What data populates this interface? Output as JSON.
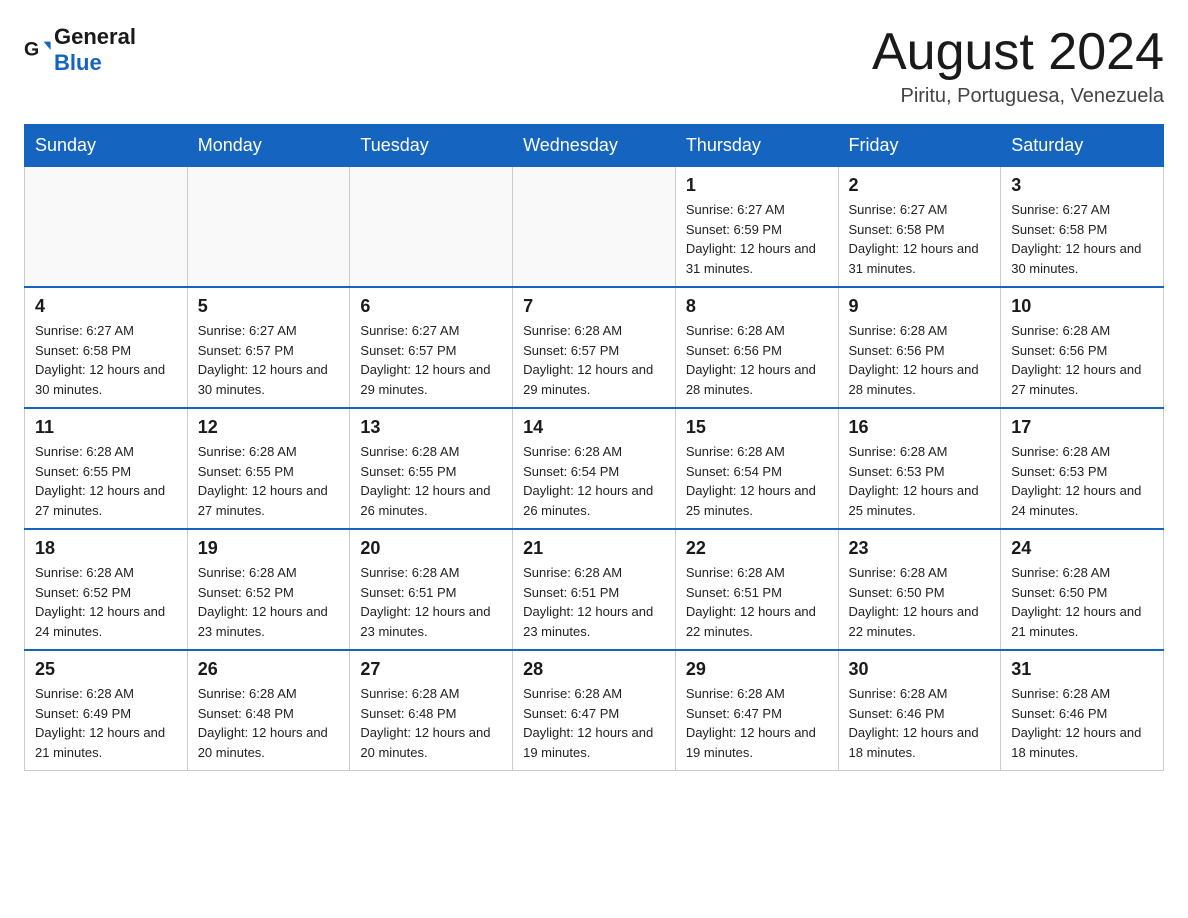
{
  "header": {
    "logo_text_general": "General",
    "logo_text_blue": "Blue",
    "month_title": "August 2024",
    "location": "Piritu, Portuguesa, Venezuela"
  },
  "weekdays": [
    "Sunday",
    "Monday",
    "Tuesday",
    "Wednesday",
    "Thursday",
    "Friday",
    "Saturday"
  ],
  "weeks": [
    [
      {
        "day": "",
        "info": ""
      },
      {
        "day": "",
        "info": ""
      },
      {
        "day": "",
        "info": ""
      },
      {
        "day": "",
        "info": ""
      },
      {
        "day": "1",
        "info": "Sunrise: 6:27 AM\nSunset: 6:59 PM\nDaylight: 12 hours and 31 minutes."
      },
      {
        "day": "2",
        "info": "Sunrise: 6:27 AM\nSunset: 6:58 PM\nDaylight: 12 hours and 31 minutes."
      },
      {
        "day": "3",
        "info": "Sunrise: 6:27 AM\nSunset: 6:58 PM\nDaylight: 12 hours and 30 minutes."
      }
    ],
    [
      {
        "day": "4",
        "info": "Sunrise: 6:27 AM\nSunset: 6:58 PM\nDaylight: 12 hours and 30 minutes."
      },
      {
        "day": "5",
        "info": "Sunrise: 6:27 AM\nSunset: 6:57 PM\nDaylight: 12 hours and 30 minutes."
      },
      {
        "day": "6",
        "info": "Sunrise: 6:27 AM\nSunset: 6:57 PM\nDaylight: 12 hours and 29 minutes."
      },
      {
        "day": "7",
        "info": "Sunrise: 6:28 AM\nSunset: 6:57 PM\nDaylight: 12 hours and 29 minutes."
      },
      {
        "day": "8",
        "info": "Sunrise: 6:28 AM\nSunset: 6:56 PM\nDaylight: 12 hours and 28 minutes."
      },
      {
        "day": "9",
        "info": "Sunrise: 6:28 AM\nSunset: 6:56 PM\nDaylight: 12 hours and 28 minutes."
      },
      {
        "day": "10",
        "info": "Sunrise: 6:28 AM\nSunset: 6:56 PM\nDaylight: 12 hours and 27 minutes."
      }
    ],
    [
      {
        "day": "11",
        "info": "Sunrise: 6:28 AM\nSunset: 6:55 PM\nDaylight: 12 hours and 27 minutes."
      },
      {
        "day": "12",
        "info": "Sunrise: 6:28 AM\nSunset: 6:55 PM\nDaylight: 12 hours and 27 minutes."
      },
      {
        "day": "13",
        "info": "Sunrise: 6:28 AM\nSunset: 6:55 PM\nDaylight: 12 hours and 26 minutes."
      },
      {
        "day": "14",
        "info": "Sunrise: 6:28 AM\nSunset: 6:54 PM\nDaylight: 12 hours and 26 minutes."
      },
      {
        "day": "15",
        "info": "Sunrise: 6:28 AM\nSunset: 6:54 PM\nDaylight: 12 hours and 25 minutes."
      },
      {
        "day": "16",
        "info": "Sunrise: 6:28 AM\nSunset: 6:53 PM\nDaylight: 12 hours and 25 minutes."
      },
      {
        "day": "17",
        "info": "Sunrise: 6:28 AM\nSunset: 6:53 PM\nDaylight: 12 hours and 24 minutes."
      }
    ],
    [
      {
        "day": "18",
        "info": "Sunrise: 6:28 AM\nSunset: 6:52 PM\nDaylight: 12 hours and 24 minutes."
      },
      {
        "day": "19",
        "info": "Sunrise: 6:28 AM\nSunset: 6:52 PM\nDaylight: 12 hours and 23 minutes."
      },
      {
        "day": "20",
        "info": "Sunrise: 6:28 AM\nSunset: 6:51 PM\nDaylight: 12 hours and 23 minutes."
      },
      {
        "day": "21",
        "info": "Sunrise: 6:28 AM\nSunset: 6:51 PM\nDaylight: 12 hours and 23 minutes."
      },
      {
        "day": "22",
        "info": "Sunrise: 6:28 AM\nSunset: 6:51 PM\nDaylight: 12 hours and 22 minutes."
      },
      {
        "day": "23",
        "info": "Sunrise: 6:28 AM\nSunset: 6:50 PM\nDaylight: 12 hours and 22 minutes."
      },
      {
        "day": "24",
        "info": "Sunrise: 6:28 AM\nSunset: 6:50 PM\nDaylight: 12 hours and 21 minutes."
      }
    ],
    [
      {
        "day": "25",
        "info": "Sunrise: 6:28 AM\nSunset: 6:49 PM\nDaylight: 12 hours and 21 minutes."
      },
      {
        "day": "26",
        "info": "Sunrise: 6:28 AM\nSunset: 6:48 PM\nDaylight: 12 hours and 20 minutes."
      },
      {
        "day": "27",
        "info": "Sunrise: 6:28 AM\nSunset: 6:48 PM\nDaylight: 12 hours and 20 minutes."
      },
      {
        "day": "28",
        "info": "Sunrise: 6:28 AM\nSunset: 6:47 PM\nDaylight: 12 hours and 19 minutes."
      },
      {
        "day": "29",
        "info": "Sunrise: 6:28 AM\nSunset: 6:47 PM\nDaylight: 12 hours and 19 minutes."
      },
      {
        "day": "30",
        "info": "Sunrise: 6:28 AM\nSunset: 6:46 PM\nDaylight: 12 hours and 18 minutes."
      },
      {
        "day": "31",
        "info": "Sunrise: 6:28 AM\nSunset: 6:46 PM\nDaylight: 12 hours and 18 minutes."
      }
    ]
  ]
}
